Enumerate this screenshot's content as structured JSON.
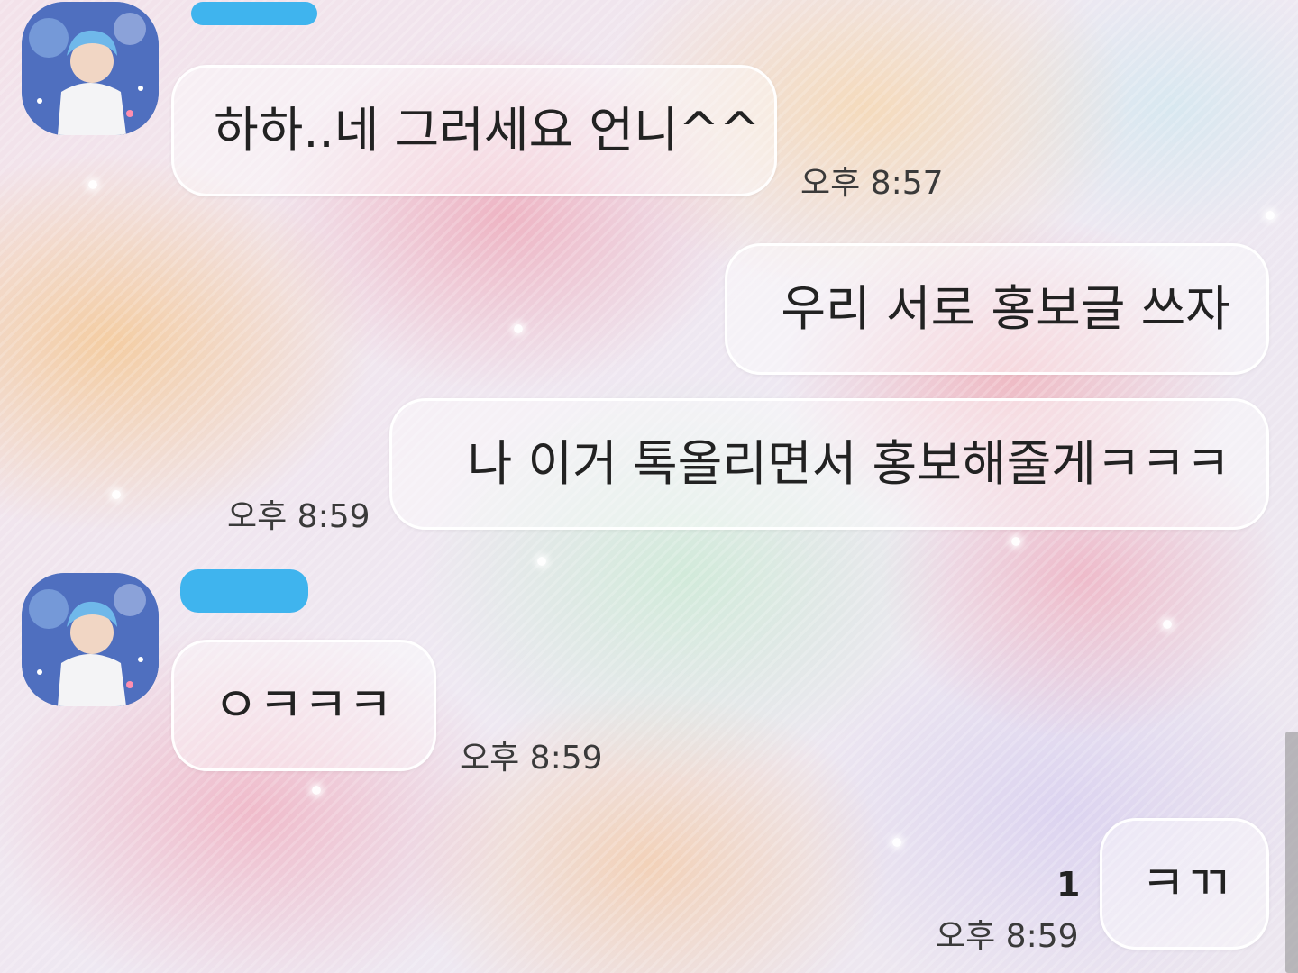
{
  "messages": [
    {
      "side": "received",
      "text": "하하..네 그러세요 언니^^",
      "time": "오후 8:57"
    },
    {
      "side": "sent",
      "text": "우리 서로 홍보글 쓰자"
    },
    {
      "side": "sent",
      "text": "나 이거 톡올리면서 홍보해줄게ㅋㅋㅋ",
      "time": "오후 8:59"
    },
    {
      "side": "received",
      "text": "ㅇㅋㅋㅋ",
      "time": "오후 8:59"
    },
    {
      "side": "sent",
      "text": "ㅋㄲ",
      "time": "오후 8:59",
      "unread_count": "1"
    }
  ],
  "icons": {
    "avatar": "profile-photo",
    "redaction": "blue-scribble"
  },
  "colors": {
    "redaction": "#3fb4ee",
    "bubble_border": "#ffffff",
    "text": "#222222"
  }
}
